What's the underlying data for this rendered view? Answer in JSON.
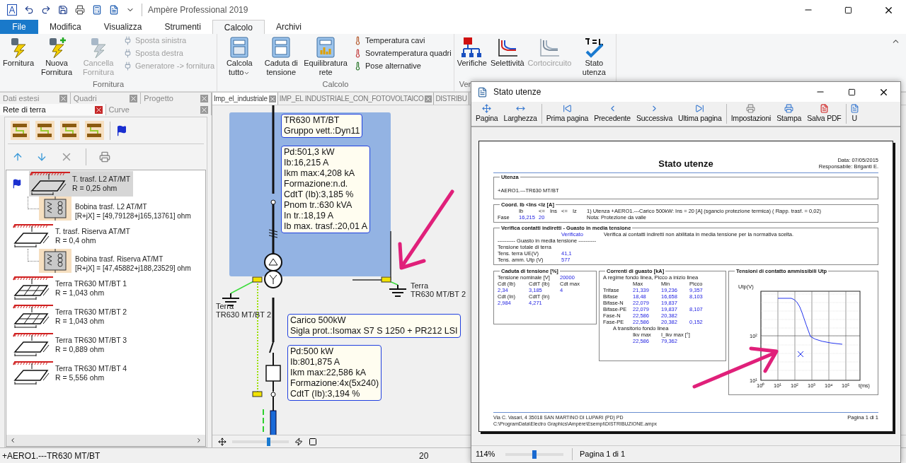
{
  "window": {
    "title": "Ampère Professional 2019"
  },
  "ribbon_tabs": [
    {
      "label": "File",
      "kind": "file",
      "selected": false
    },
    {
      "label": "Modifica",
      "kind": "tab",
      "selected": false
    },
    {
      "label": "Visualizza",
      "kind": "tab",
      "selected": false
    },
    {
      "label": "Strumenti",
      "kind": "tab",
      "selected": false
    },
    {
      "label": "Calcolo",
      "kind": "tab",
      "selected": true
    },
    {
      "label": "Archivi",
      "kind": "tab",
      "selected": false
    }
  ],
  "ribbon_groups": [
    {
      "label": "Fornitura",
      "buttons": [
        {
          "kind": "large",
          "label": "Fornitura",
          "disabled": false,
          "dropdown": false
        },
        {
          "kind": "large",
          "label": "Nuova Fornitura",
          "disabled": false,
          "dropdown": false
        },
        {
          "kind": "large",
          "label": "Cancella Fornitura",
          "disabled": true,
          "dropdown": false
        },
        {
          "kind": "small",
          "label": "Sposta sinistra",
          "disabled": true
        },
        {
          "kind": "small",
          "label": "Sposta destra",
          "disabled": true
        },
        {
          "kind": "small",
          "label": "Generatore -> fornitura",
          "disabled": true
        }
      ]
    },
    {
      "label": "Calcolo",
      "buttons": [
        {
          "kind": "large",
          "label": "Calcola tutto",
          "disabled": false,
          "dropdown": true
        },
        {
          "kind": "large",
          "label": "Caduta di tensione",
          "disabled": false,
          "dropdown": false
        },
        {
          "kind": "large",
          "label": "Equilibratura rete",
          "disabled": false,
          "dropdown": false
        },
        {
          "kind": "small",
          "label": "Temperatura cavi",
          "disabled": false
        },
        {
          "kind": "small",
          "label": "Sovratemperatura quadri",
          "disabled": false
        },
        {
          "kind": "small",
          "label": "Pose alternative",
          "disabled": false
        }
      ]
    },
    {
      "label": "Ver",
      "buttons": [
        {
          "kind": "large",
          "label": "Verifiche",
          "disabled": false,
          "dropdown": false
        },
        {
          "kind": "large",
          "label": "Selettività",
          "disabled": false,
          "dropdown": false
        },
        {
          "kind": "large",
          "label": "Cortocircuito",
          "disabled": true,
          "dropdown": false
        },
        {
          "kind": "large",
          "label": "Stato utenza",
          "disabled": false,
          "dropdown": false
        }
      ]
    }
  ],
  "left_panel": {
    "tab_rows": [
      [
        {
          "label": "Dati estesi",
          "selected": false
        },
        {
          "label": "Quadri",
          "selected": false
        },
        {
          "label": "Progetto",
          "selected": false
        }
      ],
      [
        {
          "label": "Rete di terra",
          "selected": true
        },
        {
          "label": "Curve",
          "selected": false
        }
      ]
    ],
    "tree": [
      {
        "kind": "plate",
        "name": "T. trasf. L2 AT/MT",
        "value": "R = 0,25 ohm",
        "selected": true,
        "marked": true,
        "children": [
          {
            "kind": "coil",
            "name": "Bobina trasf. L2 AT/MT",
            "value": "[R+jX] = [49,79128+j165,13761] ohm",
            "selected": false,
            "marked": false
          }
        ]
      },
      {
        "kind": "plate",
        "name": "T. trasf. Riserva AT/MT",
        "value": "R = 0,4 ohm",
        "selected": false,
        "marked": false,
        "children": [
          {
            "kind": "coil",
            "name": "Bobina trasf. Riserva AT/MT",
            "value": "[R+jX] = [47,45882+j188,23529] ohm",
            "selected": false,
            "marked": false
          }
        ]
      },
      {
        "kind": "mesh",
        "name": "Terra TR630 MT/BT 1",
        "value": "R = 1,043 ohm",
        "selected": false,
        "marked": false
      },
      {
        "kind": "mesh",
        "name": "Terra TR630 MT/BT 2",
        "value": "R = 1,043 ohm",
        "selected": false,
        "marked": false
      },
      {
        "kind": "plate",
        "name": "Terra TR630 MT/BT 3",
        "value": "R = 0,889 ohm",
        "selected": false,
        "marked": false
      },
      {
        "kind": "plate",
        "name": "Terra TR630 MT/BT 4",
        "value": "R = 5,556 ohm",
        "selected": false,
        "marked": false
      }
    ]
  },
  "diagram": {
    "tabs": [
      {
        "label": "Imp_el_industriale",
        "selected": true
      },
      {
        "label": "IMP_EL INDUSTRIALE_CON_FOTOVOLTAICO",
        "selected": false
      },
      {
        "label": "DISTRIBU",
        "selected": false
      }
    ],
    "boxes": [
      {
        "lines": [
          "TR630 MT/BT",
          "Gruppo vett.:Dyn11"
        ]
      },
      {
        "lines": [
          "Pd:501,3 kW",
          "Ib:16,215 A",
          "Ikm max:4,208 kA",
          "Formazione:n.d.",
          "CdtT (Ib):3,185 %",
          "Pnom tr.:630 kVA",
          "In tr.:18,19 A",
          "Ib max. trasf.:20,01 A"
        ]
      },
      {
        "lines": [
          "Carico 500kW",
          "Sigla prot.:Isomax S7 S 1250 + PR212 LSI"
        ]
      },
      {
        "lines": [
          "Pd:500 kW",
          "Ib:801,875 A",
          "Ikm max:22,586 kA",
          "Formazione:4x(5x240)",
          "CdtT (Ib):3,194 %"
        ]
      }
    ],
    "earths": [
      {
        "lines": [
          "Terra",
          "TR630 MT/BT 2"
        ]
      },
      {
        "lines": [
          "Terra",
          "TR630 MT/BT 2"
        ]
      }
    ],
    "zoom_slider": {
      "level": 0.65
    }
  },
  "status_bar": {
    "path": "+AERO1.---TR630 MT/BT",
    "value": "20"
  },
  "preview": {
    "title": "Stato utenze",
    "toolbar": [
      [
        {
          "label": "Pagina"
        },
        {
          "label": "Larghezza"
        }
      ],
      [
        {
          "label": "Prima pagina"
        },
        {
          "label": "Precedente"
        },
        {
          "label": "Successiva"
        },
        {
          "label": "Ultima pagina"
        }
      ],
      [
        {
          "label": "Impostazioni"
        },
        {
          "label": "Stampa"
        },
        {
          "label": "Salva PDF"
        }
      ],
      [
        {
          "label": "U"
        }
      ]
    ],
    "zoom": "114%",
    "zoom_slider": {
      "level": 0.5
    },
    "page_status": "Pagina 1 di 1",
    "report": {
      "title": "Stato utenze",
      "date": "Data: 07/05/2015",
      "responsible": "Responsabile: Briganti E.",
      "utenza": {
        "legend": "Utenza",
        "value": "+AERO1.---TR630 MT/BT"
      },
      "coord": {
        "legend": "Coord. Ib <Ins <Iz [A]",
        "header": [
          "Ib",
          "<=",
          "Ins",
          "<=",
          "Iz"
        ],
        "row": [
          "Fase",
          "16,215",
          "20"
        ],
        "note": "1) Utenza +AERO1.---Carico 500kW: Ins = 20 [A] (sgancio protezione termica) ( Rapp. trasf. = 0,02)",
        "note2": "Nota: Protezione da valle"
      },
      "verifica": {
        "legend": "Verifica contatti indiretti - Guasto in media tensione",
        "status": "Verificato",
        "message": "Verifica ai contatti indiretti non abilitata in media tensione per la normativa scelta.",
        "subtitle": "---------- Guasto in media tensione ----------",
        "rows": [
          {
            "label": "Tensione totale di terra"
          },
          {
            "label": "Tens. terra UE(V)",
            "value": "41,1"
          },
          {
            "label": "Tens. amm. Utp (V)",
            "value": "577"
          }
        ]
      },
      "caduta": {
        "legend": "Caduta di tensione [%]",
        "lines": [
          [
            {
              "text": "Tensione nominale [V]",
              "kind": "label"
            },
            {
              "text": "20000",
              "kind": "value"
            }
          ],
          [
            {
              "text": "Cdt (Ib)",
              "kind": "label"
            },
            {
              "text": "CdtT (Ib)",
              "kind": "label"
            },
            {
              "text": "Cdt max",
              "kind": "label"
            }
          ],
          [
            {
              "text": "2,34",
              "kind": "value"
            },
            {
              "text": "3,185",
              "kind": "value"
            },
            {
              "text": "4",
              "kind": "value"
            }
          ],
          [
            {
              "text": "Cdt (In)",
              "kind": "label"
            },
            {
              "text": "CdtT (In)",
              "kind": "label"
            }
          ],
          [
            {
              "text": "2,984",
              "kind": "value"
            },
            {
              "text": "4,271",
              "kind": "value"
            }
          ]
        ]
      },
      "correnti": {
        "legend": "Correnti di guasto [kA]",
        "intro": "A regime fondo linea, Picco a inizio linea",
        "header": [
          "Max",
          "Min",
          "Picco"
        ],
        "rows": [
          {
            "label": "Trifase",
            "values": [
              "21,339",
              "19,236",
              "9,357"
            ]
          },
          {
            "label": "Bifase",
            "values": [
              "18,48",
              "16,658",
              "8,103"
            ]
          },
          {
            "label": "Bifase-N",
            "values": [
              "22,079",
              "19,837"
            ]
          },
          {
            "label": "Bifase-PE",
            "values": [
              "22,079",
              "19,837",
              "8,107"
            ]
          },
          {
            "label": "Fase-N",
            "values": [
              "22,586",
              "20,382"
            ]
          },
          {
            "label": "Fase-PE",
            "values": [
              "22,586",
              "20,382",
              "0,152"
            ]
          }
        ],
        "transient": "A transitorio fondo linea",
        "transient_header": [
          "Ikv max",
          "I_ikv max [°]"
        ],
        "transient_values": [
          "22,586",
          "79,362"
        ]
      },
      "chart": {
        "legend": "Tensioni di contatto ammissibili Utp",
        "ylabel": "Utp(V)",
        "xlabel": "t(ms)",
        "xticks": [
          "10⁰",
          "10¹",
          "10²",
          "10³",
          "10⁴",
          "10⁵"
        ],
        "yticks": [
          "10²",
          "10¹"
        ]
      },
      "footer": {
        "lines": [
          "Via C. Vasari, 4 35018 SAN MARTINO DI LUPARI (PD) PD",
          "C:\\ProgramData\\Electro Graphics\\Ampère\\Esempi\\DISTRIBUZIONE.ampx"
        ],
        "page": "Pagina 1 di 1"
      }
    }
  }
}
